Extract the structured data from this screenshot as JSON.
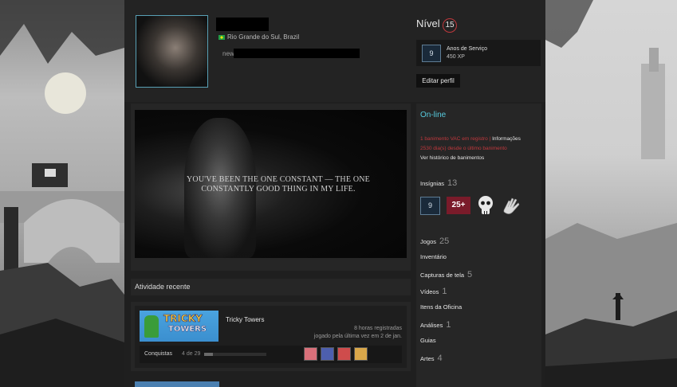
{
  "profile": {
    "location": "Rio Grande do Sul, Brazil",
    "summary_prefix": "new"
  },
  "level": {
    "label": "Nível",
    "value": "15"
  },
  "service_badge": {
    "icon_text": "9",
    "title": "Anos de Serviço",
    "xp": "450 XP"
  },
  "edit_profile_label": "Editar perfil",
  "showcase": {
    "quote": "YOU'VE BEEN THE ONE CONSTANT — THE ONE CONSTANTLY GOOD THING IN MY LIFE."
  },
  "recent_activity": {
    "header": "Atividade recente",
    "game": {
      "logo_line1": "TRICKY",
      "logo_line2": "TOWERS",
      "title": "Tricky Towers",
      "hours": "8 horas registradas",
      "last_played": "jogado pela última vez em 2 de jan.",
      "achievements_label": "Conquistas",
      "achievements_count": "4 de 29",
      "achievements_progress": 0.14,
      "achievement_colors": [
        "#d9707a",
        "#4d5fae",
        "#cf4c4c",
        "#d9a74a"
      ]
    }
  },
  "right": {
    "status": "On-line",
    "vac_line1": "1 banimento VAC em registro | ",
    "vac_info": "Informações",
    "vac_line2": "2530 dia(s) desde o último banimento",
    "vac_history": "Ver histórico de banimentos",
    "badges_label": "Insígnias",
    "badges_count": "13",
    "badge_svc_text": "9",
    "badge_25_text": "25+",
    "stats": [
      {
        "label": "Jogos",
        "count": "25"
      },
      {
        "label": "Inventário",
        "count": ""
      },
      {
        "label": "Capturas de tela",
        "count": "5"
      },
      {
        "label": "Vídeos",
        "count": "1"
      },
      {
        "label": "Itens da Oficina",
        "count": ""
      },
      {
        "label": "Análises",
        "count": "1"
      },
      {
        "label": "Guias",
        "count": ""
      },
      {
        "label": "Artes",
        "count": "4"
      }
    ]
  },
  "colors": {
    "online": "#57cbde",
    "vac_red": "#c0383d",
    "level_ring": "#c0383d"
  }
}
